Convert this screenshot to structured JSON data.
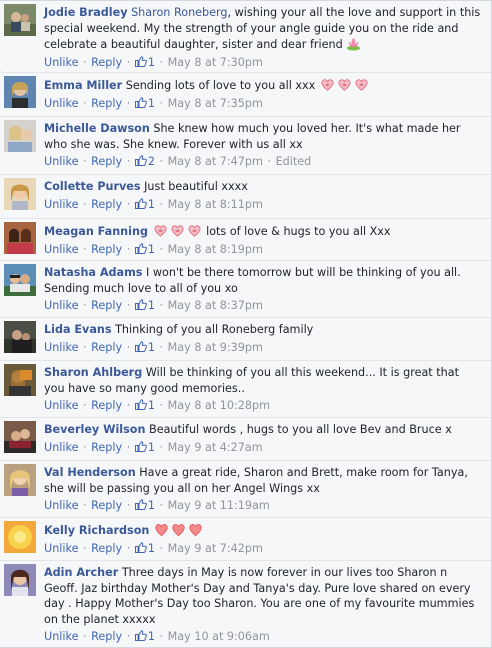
{
  "comments": [
    {
      "author": "Jodie Bradley",
      "mention": "Sharon Roneberg",
      "text": ", wishing your all the love and support in this special weekend. My the strength of your angle guide you on the ride and celebrate a beautiful daughter, sister and dear friend",
      "emoji": "lotus-icon",
      "likes": "1",
      "time": "May 8 at 7:30pm"
    },
    {
      "author": "Emma Miller",
      "text": "Sending lots of love to you all xxx",
      "emoji": "heart-ribbon-icon x3",
      "likes": "1",
      "time": "May 8 at 7:35pm"
    },
    {
      "author": "Michelle Dawson",
      "text": "She knew how much you loved her. It's what made her who she was. She knew. Forever with us all xx",
      "likes": "2",
      "time": "May 8 at 7:47pm",
      "edited": "Edited"
    },
    {
      "author": "Collette Purves",
      "text": "Just beautiful xxxx",
      "likes": "1",
      "time": "May 8 at 8:11pm"
    },
    {
      "author": "Meagan Fanning",
      "text": "lots of love & hugs to you all Xxx",
      "emoji": "heart-ribbon-icon x3",
      "likes": "1",
      "time": "May 8 at 8:19pm"
    },
    {
      "author": "Natasha Adams",
      "text": "I won't be there tomorrow but will be thinking of you all. Sending much love to all of you xo",
      "likes": "1",
      "time": "May 8 at 8:37pm"
    },
    {
      "author": "Lida Evans",
      "text": "Thinking of you all Roneberg family",
      "likes": "1",
      "time": "May 8 at 9:39pm"
    },
    {
      "author": "Sharon Ahlberg",
      "text": "Will be thinking of you all this weekend... It is great that you have so many good memories..",
      "likes": "1",
      "time": "May 8 at 10:28pm"
    },
    {
      "author": "Beverley Wilson",
      "text": "Beautiful words , hugs to you all love Bev and Bruce x",
      "likes": "1",
      "time": "May 9 at 4:27am"
    },
    {
      "author": "Val Henderson",
      "text": "Have a great ride, Sharon and Brett, make room for Tanya, she will be passing you all on her Angel Wings xx",
      "likes": "1",
      "time": "May 9 at 11:19am"
    },
    {
      "author": "Kelly Richardson",
      "text": "",
      "emoji": "heart-icon x3",
      "likes": "1",
      "time": "May 9 at 7:42pm"
    },
    {
      "author": "Adin Archer",
      "text": "Three days in May is now forever in our lives too Sharon n Geoff. Jaz birthday Mother's Day and Tanya's day. Pure love shared on every day . Happy Mother's Day too Sharon. You are one of my favourite mummies on the planet xxxxx",
      "likes": "1",
      "time": "May 10 at 9:06am"
    }
  ],
  "actions": {
    "unlike": "Unlike",
    "reply": "Reply",
    "sep": "·"
  },
  "colors": {
    "link": "#3b5998",
    "meta": "#90949c",
    "background": "#f6f7f9"
  }
}
